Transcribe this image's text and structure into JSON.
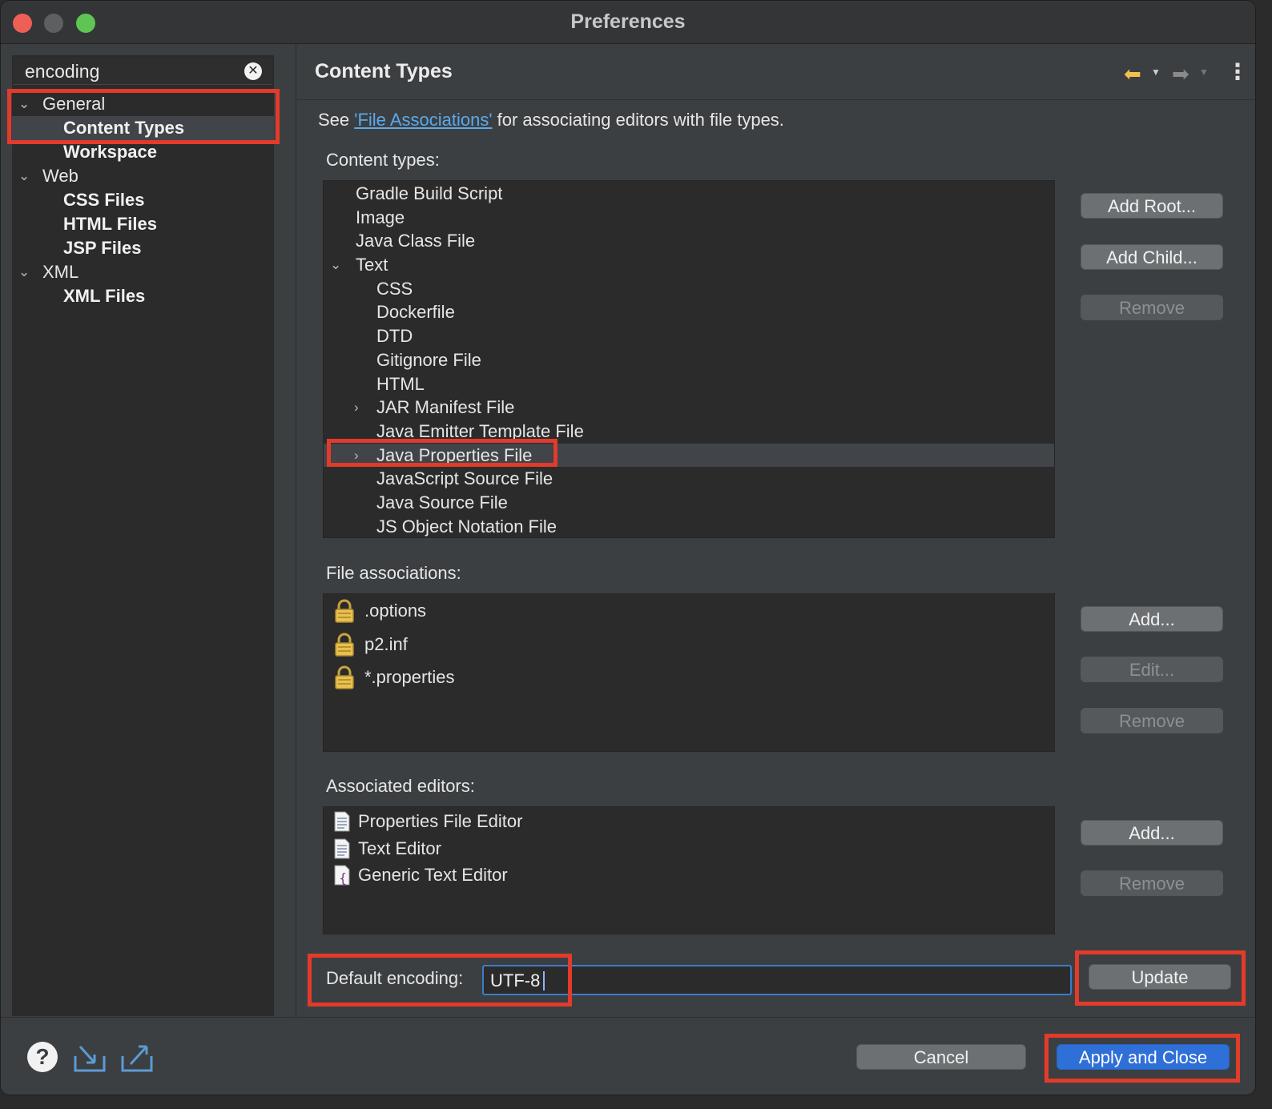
{
  "window": {
    "title": "Preferences"
  },
  "sidebar": {
    "search_value": "encoding",
    "tree": [
      {
        "label": "General",
        "level": 0,
        "expanded": true
      },
      {
        "label": "Content Types",
        "level": 1,
        "selected": true
      },
      {
        "label": "Workspace",
        "level": 1
      },
      {
        "label": "Web",
        "level": 0,
        "expanded": true
      },
      {
        "label": "CSS Files",
        "level": 1
      },
      {
        "label": "HTML Files",
        "level": 1
      },
      {
        "label": "JSP Files",
        "level": 1
      },
      {
        "label": "XML",
        "level": 0,
        "expanded": true
      },
      {
        "label": "XML Files",
        "level": 1
      }
    ]
  },
  "page": {
    "title": "Content Types",
    "see_prefix": "See ",
    "see_link": "'File Associations'",
    "see_suffix": " for associating editors with file types.",
    "content_types_label": "Content types:",
    "content_types": [
      {
        "label": "Gradle Build Script",
        "indent": 0
      },
      {
        "label": "Image",
        "indent": 0
      },
      {
        "label": "Java Class File",
        "indent": 0
      },
      {
        "label": "Text",
        "indent": 0,
        "chevron": "down"
      },
      {
        "label": "CSS",
        "indent": 1
      },
      {
        "label": "Dockerfile",
        "indent": 1
      },
      {
        "label": "DTD",
        "indent": 1
      },
      {
        "label": "Gitignore File",
        "indent": 1
      },
      {
        "label": "HTML",
        "indent": 1
      },
      {
        "label": "JAR Manifest File",
        "indent": 1,
        "chevron": "right"
      },
      {
        "label": "Java Emitter Template File",
        "indent": 1
      },
      {
        "label": "Java Properties File",
        "indent": 1,
        "chevron": "right",
        "selected": true
      },
      {
        "label": "JavaScript Source File",
        "indent": 1
      },
      {
        "label": "Java Source File",
        "indent": 1
      },
      {
        "label": "JS Object Notation File",
        "indent": 1
      }
    ],
    "content_type_buttons": {
      "add_root": "Add Root...",
      "add_child": "Add Child...",
      "remove": "Remove"
    },
    "file_associations_label": "File associations:",
    "file_associations": [
      ".options",
      "p2.inf",
      "*.properties"
    ],
    "file_association_buttons": {
      "add": "Add...",
      "edit": "Edit...",
      "remove": "Remove"
    },
    "associated_editors_label": "Associated editors:",
    "associated_editors": [
      {
        "label": "Properties File Editor",
        "icon": "document-icon"
      },
      {
        "label": "Text Editor",
        "icon": "document-icon"
      },
      {
        "label": "Generic Text Editor",
        "icon": "generic-editor-icon"
      }
    ],
    "editor_buttons": {
      "add": "Add...",
      "remove": "Remove"
    },
    "default_encoding_label": "Default encoding:",
    "default_encoding_value": "UTF-8",
    "update_button": "Update"
  },
  "footer": {
    "cancel": "Cancel",
    "apply_close": "Apply and Close"
  },
  "colors": {
    "highlight_box": "#e23b2b",
    "primary_button": "#2f6fd8",
    "link": "#5aa9ee"
  }
}
